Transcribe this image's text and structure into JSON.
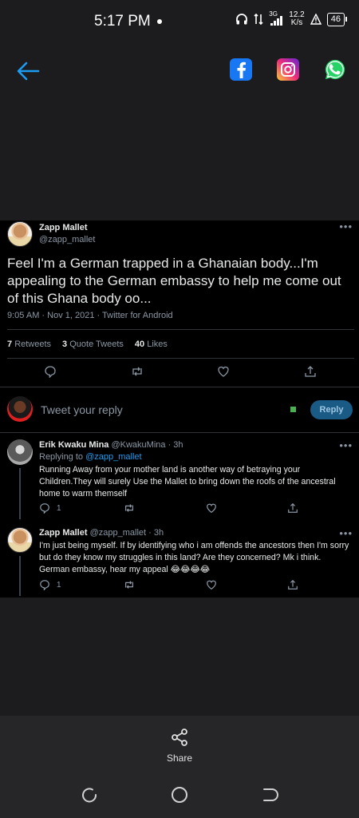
{
  "status_bar": {
    "time": "5:17 PM",
    "network": "3G",
    "speed_value": "12.2",
    "speed_unit": "K/s",
    "battery": "46"
  },
  "share_bar": {
    "back_icon": "arrow-left-icon",
    "targets": [
      "facebook",
      "instagram",
      "whatsapp"
    ]
  },
  "tweet": {
    "author_name": "Zapp Mallet",
    "author_handle": "@zapp_mallet",
    "text": "Feel I'm a German trapped in a Ghanaian body...I'm appealing to the German embassy to help me come out of this Ghana body oo...",
    "meta": "9:05 AM · Nov 1, 2021 · Twitter for Android",
    "stats": [
      {
        "count": "7",
        "label": "Retweets"
      },
      {
        "count": "3",
        "label": "Quote Tweets"
      },
      {
        "count": "40",
        "label": "Likes"
      }
    ]
  },
  "composer": {
    "placeholder": "Tweet your reply",
    "button": "Reply"
  },
  "replies": [
    {
      "name": "Erik Kwaku Mina",
      "handle": "@KwakuMina · 3h",
      "replying_prefix": "Replying to",
      "replying_to": "@zapp_mallet",
      "text": "Running Away from your mother land is another way of betraying your Children.They will surely Use the Mallet to bring down the roofs of the ancestral home to warm themself",
      "reply_count": "1"
    },
    {
      "name": "Zapp Mallet",
      "handle": "@zapp_mallet · 3h",
      "text": "I'm just being myself. If by identifying who i am offends the ancestors then I'm sorry but do they know my struggles in this land? Are they concerned? Mk i think. German embassy, hear my appeal 😂😂😂😂",
      "reply_count": "1"
    }
  ],
  "bottom": {
    "share_label": "Share"
  },
  "colors": {
    "link": "#1d9bf0",
    "background": "#000000",
    "muted": "#8b98a5"
  }
}
